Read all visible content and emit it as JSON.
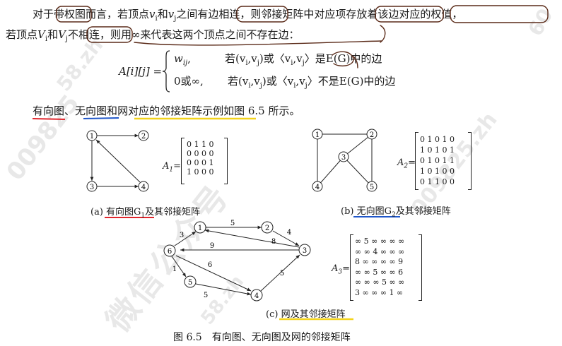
{
  "text": {
    "l1_a": "对于",
    "l1_b": "带权图",
    "l1_c": "而言，若顶点",
    "l1_vi": "v",
    "l1_sub_i": "i",
    "l1_d": "和",
    "l1_vj": "v",
    "l1_sub_j": "j",
    "l1_e": "之间",
    "l1_f": "有边相连",
    "l1_g": "，则邻接矩阵中",
    "l1_h": "对应项存放着",
    "l1_i": "该边对应的权值",
    "l1_j": "，",
    "l2_a": "若顶点",
    "l2_Vi": "V",
    "l2_sub_i": "i",
    "l2_b": "和",
    "l2_Vj": "V",
    "l2_sub_j": "j",
    "l2_c": "不相连",
    "l2_d": "，则用∞来代表这两个顶点之间不存在边：",
    "eq_lhs": "A[i][j] =",
    "eq_case1_val": "w",
    "eq_case1_sub": "ij",
    "eq_case1_cond": "若(v",
    "eq_case1_cond_b": ",v",
    "eq_case1_cond_c": ")或〈v",
    "eq_case1_cond_d": ",v",
    "eq_case1_cond_e": "〉是E(G)中的边",
    "eq_case2_val": "0或∞,",
    "eq_case2_cond": "若(v",
    "eq_case2_cond_b": ",v",
    "eq_case2_cond_c": ")或〈v",
    "eq_case2_cond_d": ",v",
    "eq_case2_cond_e": "〉不是E(G)中的边",
    "eq_sub_i": "i",
    "eq_sub_j": "j",
    "l3_a": "有向图",
    "l3_b": "、",
    "l3_c": "无向图",
    "l3_d": "和",
    "l3_e": "网对应的邻接矩阵示例",
    "l3_f": "如图 6.5 所示。",
    "cap_a_prefix": "(a) ",
    "cap_a": "有向图G",
    "cap_a_sub": "1",
    "cap_a_suffix": "及其邻接矩阵",
    "cap_b_prefix": "(b) ",
    "cap_b": "无向图G",
    "cap_b_sub": "2",
    "cap_b_suffix": "及其邻接矩阵",
    "cap_c_prefix": "(c) ",
    "cap_c": "网及其邻接矩阵",
    "fig_caption": "图 6.5　有向图、无向图及网的邻接矩阵",
    "A1_label": "A",
    "A1_sub": "1",
    "A2_label": "A",
    "A2_sub": "2",
    "A3_label": "A",
    "A3_sub": "3",
    "eq_sign": "="
  },
  "matrices": {
    "A1": [
      "0 1 1 0",
      "0 0 0 0",
      "0 0 0 1",
      "1 0 0 0"
    ],
    "A2": [
      "0 1 0 1 0",
      "1 0 1 0 1",
      "0 1 0 1 1",
      "1 0 1 0 0",
      "0 1 1 0 0"
    ],
    "A3": [
      "∞ 5 ∞ ∞ ∞ ∞",
      "∞ ∞ 4 ∞ ∞ ∞",
      "8 ∞ ∞ ∞ ∞ 9",
      "∞ ∞ 5 ∞ ∞ 6",
      "∞ ∞ ∞ 5 ∞ ∞",
      "3 ∞ ∞ ∞ 1 ∞"
    ]
  },
  "graphs": {
    "G1_nodes": [
      "1",
      "2",
      "3",
      "4"
    ],
    "G2_nodes": [
      "1",
      "2",
      "3",
      "4",
      "5"
    ],
    "G3_nodes": [
      "1",
      "2",
      "3",
      "4",
      "5",
      "6"
    ],
    "G3_weights": [
      "5",
      "4",
      "3",
      "9",
      "8",
      "6",
      "1",
      "5",
      "5"
    ]
  },
  "watermarks": [
    "009825",
    "58.zh",
    "60",
    "微信公众号",
    "009825.zh",
    "58.zh"
  ],
  "colors": {
    "underline_red": "#e0262d",
    "underline_blue": "#1f56c9",
    "underline_yellow": "#f3d31b",
    "pen": "#5a2a18"
  }
}
